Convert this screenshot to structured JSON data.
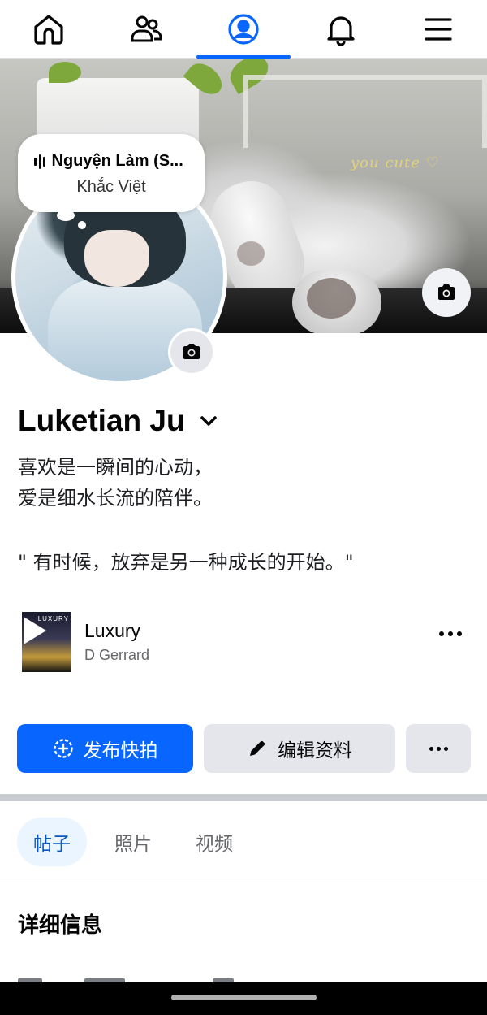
{
  "nav": {
    "tabs": [
      {
        "name": "home",
        "icon": "home-icon"
      },
      {
        "name": "friends",
        "icon": "friends-icon"
      },
      {
        "name": "profile",
        "icon": "profile-icon",
        "active": true
      },
      {
        "name": "notifications",
        "icon": "bell-icon"
      },
      {
        "name": "menu",
        "icon": "hamburger-icon"
      }
    ],
    "active_color": "#0866ff"
  },
  "cover": {
    "overlay_text": "you cute ♡"
  },
  "music_bubble": {
    "track": "Nguyện Làm (S...",
    "artist": "Khắc Việt"
  },
  "profile": {
    "name": "Luketian Ju",
    "bio_line1": "喜欢是一瞬间的心动，",
    "bio_line2": "爱是细水长流的陪伴。",
    "quote": "\" 有时候，放弃是另一种成长的开始。\""
  },
  "profile_music": {
    "title": "Luxury",
    "artist": "D Gerrard",
    "art_text": "LUXURY"
  },
  "actions": {
    "primary_label": "发布快拍",
    "secondary_label": "编辑资料",
    "primary_color": "#0866ff"
  },
  "content_tabs": [
    {
      "label": "帖子",
      "active": true
    },
    {
      "label": "照片",
      "active": false
    },
    {
      "label": "视频",
      "active": false
    }
  ],
  "details_title": "详细信息"
}
